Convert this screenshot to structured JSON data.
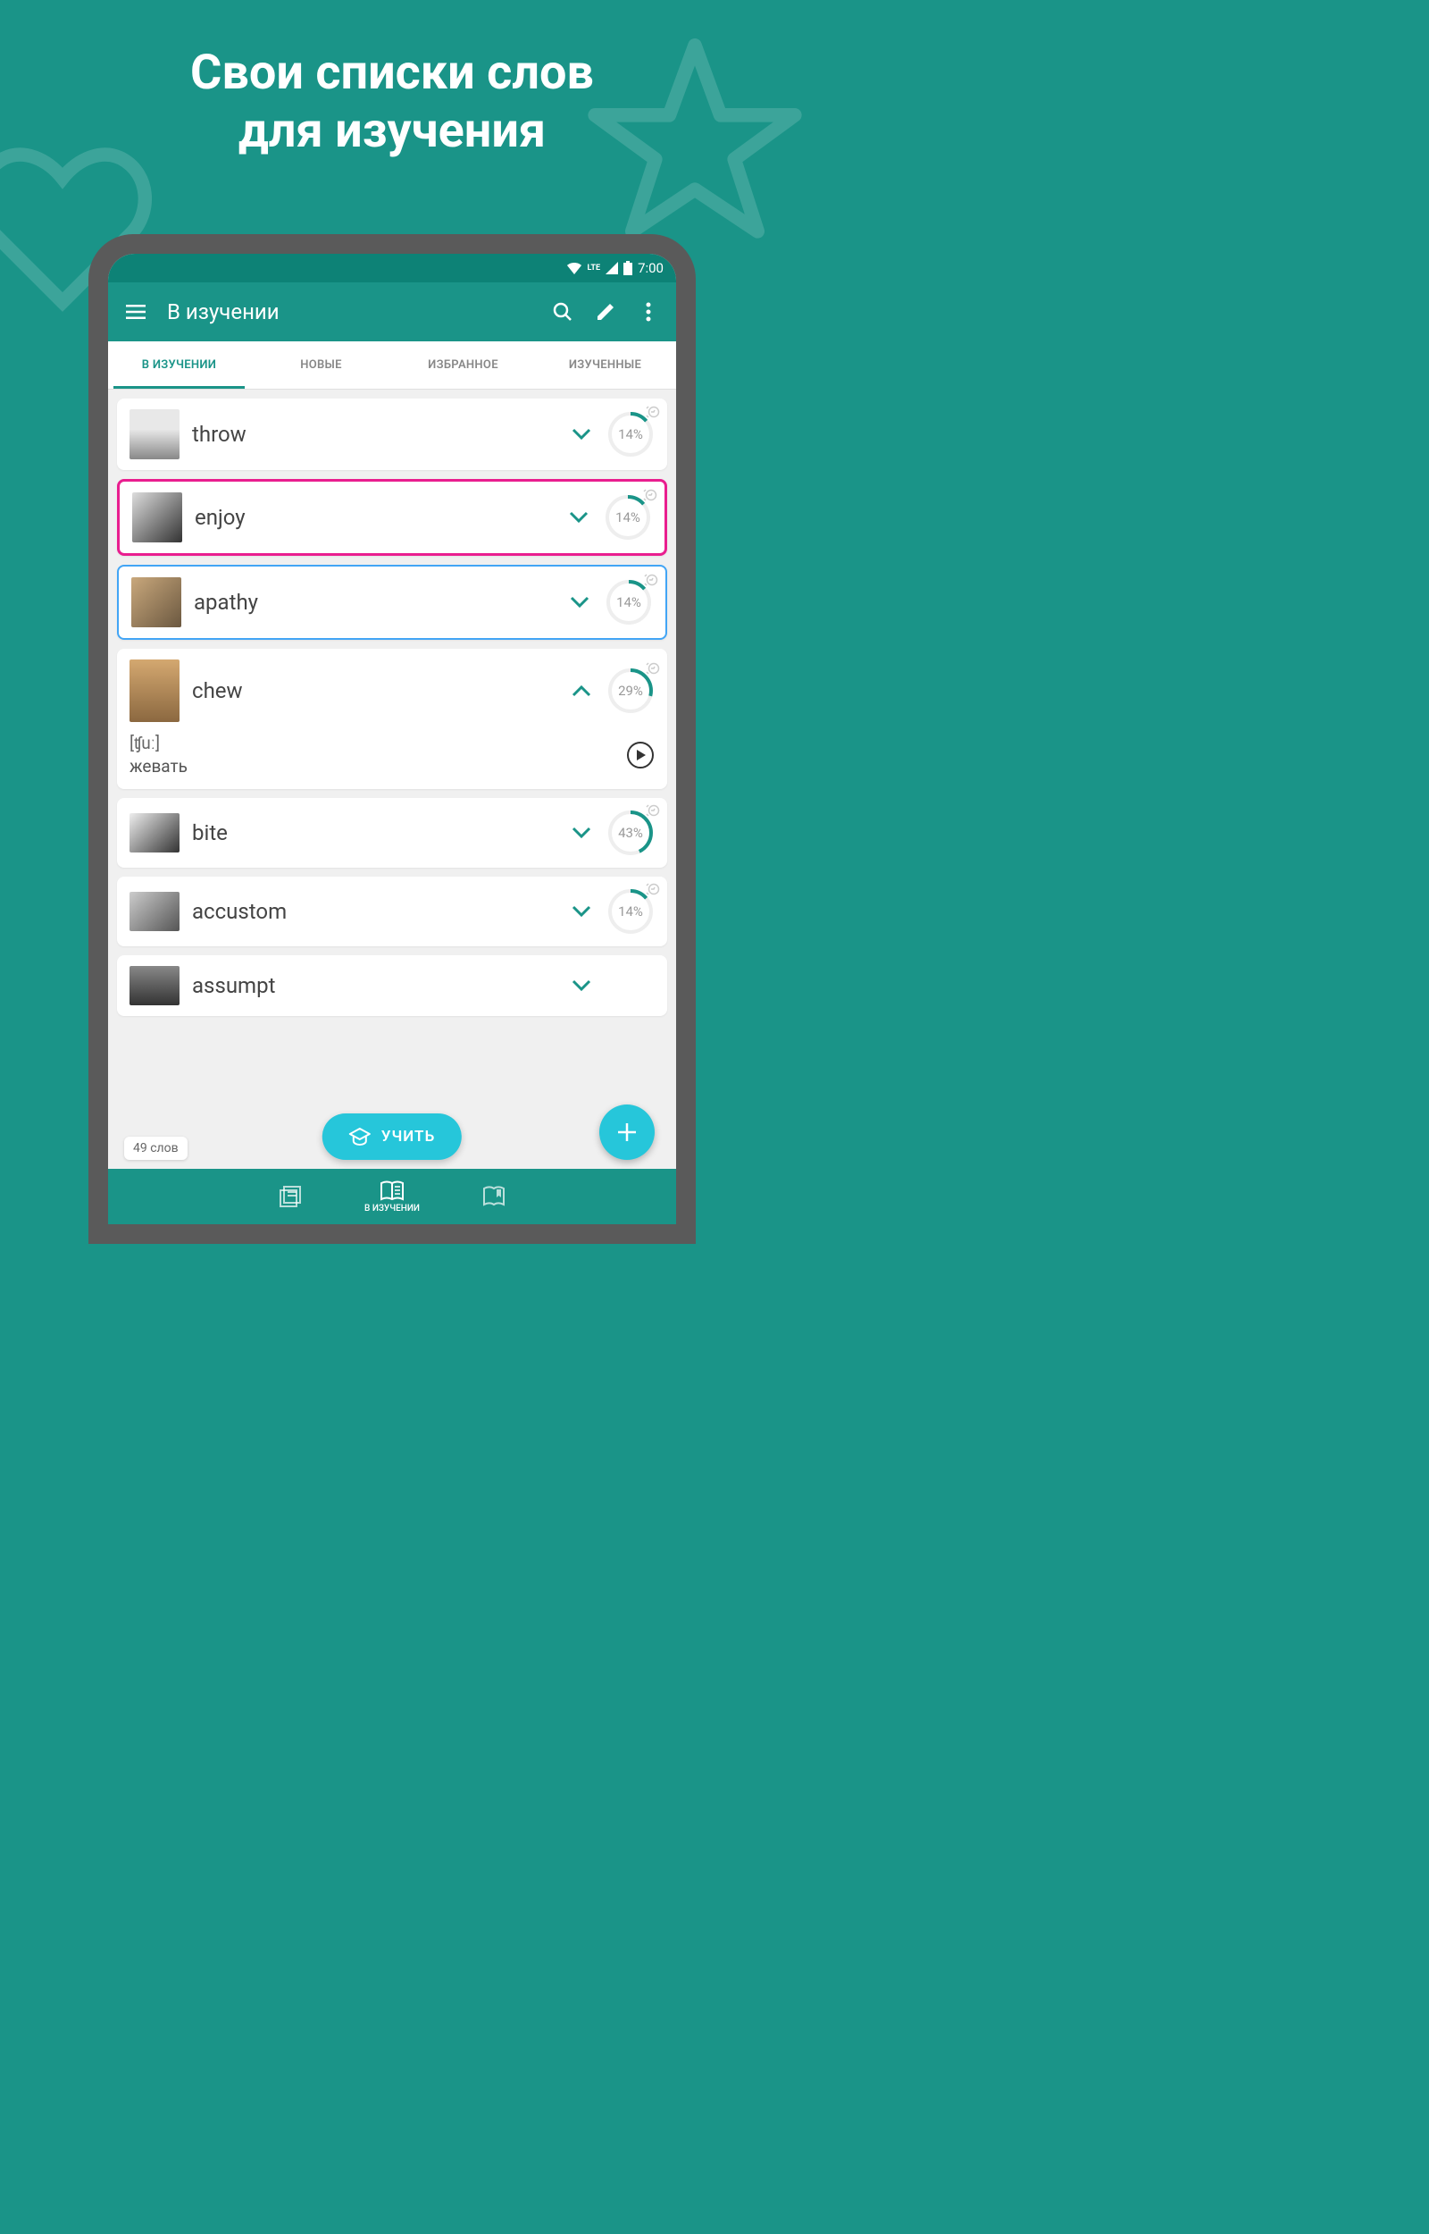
{
  "headline_line1": "Свои списки слов",
  "headline_line2": "для изучения",
  "status": {
    "time": "7:00",
    "net": "LTE"
  },
  "appbar": {
    "title": "В изучении"
  },
  "tabs": [
    {
      "label": "В ИЗУЧЕНИИ",
      "active": true
    },
    {
      "label": "НОВЫЕ",
      "active": false
    },
    {
      "label": "ИЗБРАННОЕ",
      "active": false
    },
    {
      "label": "ИЗУЧЕННЫЕ",
      "active": false
    }
  ],
  "words": [
    {
      "word": "throw",
      "pct": "14%",
      "progress": 14,
      "expanded": false,
      "highlight": ""
    },
    {
      "word": "enjoy",
      "pct": "14%",
      "progress": 14,
      "expanded": false,
      "highlight": "pink"
    },
    {
      "word": "apathy",
      "pct": "14%",
      "progress": 14,
      "expanded": false,
      "highlight": "blue"
    },
    {
      "word": "chew",
      "pct": "29%",
      "progress": 29,
      "expanded": true,
      "highlight": "",
      "transcription": "[ʧuː]",
      "translation": "жевать"
    },
    {
      "word": "bite",
      "pct": "43%",
      "progress": 43,
      "expanded": false,
      "highlight": ""
    },
    {
      "word": "accustom",
      "pct": "14%",
      "progress": 14,
      "expanded": false,
      "highlight": ""
    },
    {
      "word": "assumpt",
      "pct": "",
      "progress": 0,
      "expanded": false,
      "highlight": ""
    }
  ],
  "word_count": "49 слов",
  "learn_btn": "УЧИТЬ",
  "bottom_nav": {
    "learning": "В ИЗУЧЕНИИ"
  }
}
